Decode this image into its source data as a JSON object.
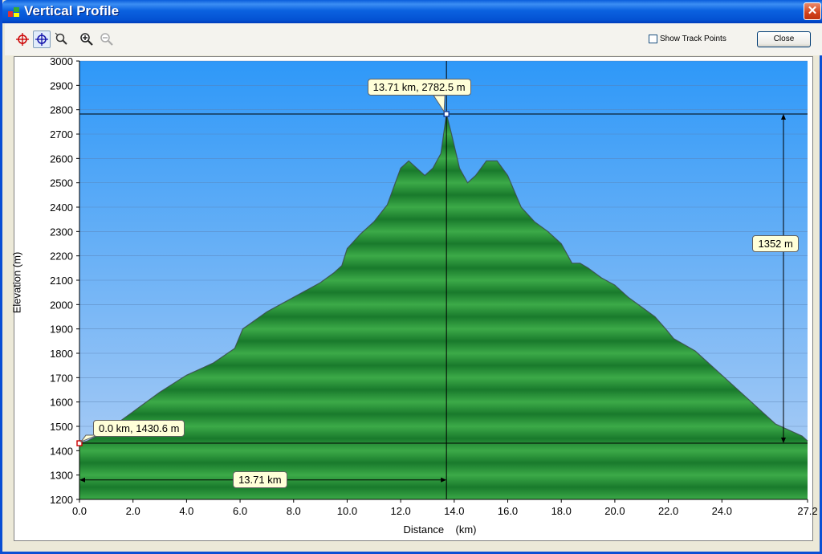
{
  "window": {
    "title": "Vertical Profile",
    "close_glyph": "✕"
  },
  "toolbar": {
    "tools": [
      {
        "icon": "crosshair-red-icon"
      },
      {
        "icon": "crosshair-blue-icon"
      },
      {
        "icon": "zoom-select-icon"
      },
      {
        "icon": "zoom-in-icon"
      },
      {
        "icon": "zoom-out-icon"
      }
    ],
    "show_track_points_label": "Show Track Points",
    "show_track_points_checked": false,
    "close_label": "Close"
  },
  "colors": {
    "sky_top": "#2e98f8",
    "sky_bottom": "#b4d0f4",
    "fill_light": "#3caa48",
    "fill_dark": "#197a2c"
  },
  "chart_data": {
    "type": "area",
    "title": "",
    "xlabel": "Distance    (km)",
    "ylabel": "Elevation (m)",
    "xlim": [
      0,
      27.2
    ],
    "ylim": [
      1200,
      3000
    ],
    "x_ticks": [
      "0.0",
      "2.0",
      "4.0",
      "6.0",
      "8.0",
      "10.0",
      "12.0",
      "14.0",
      "16.0",
      "18.0",
      "20.0",
      "22.0",
      "24.0",
      "27.2"
    ],
    "y_ticks": [
      1200,
      1300,
      1400,
      1500,
      1600,
      1700,
      1800,
      1900,
      2000,
      2100,
      2200,
      2300,
      2400,
      2500,
      2600,
      2700,
      2800,
      2900,
      3000
    ],
    "grid": true,
    "series": [
      {
        "x": [
          0,
          0.3,
          1,
          2,
          3,
          4,
          5,
          5.8,
          6.1,
          7,
          8,
          9,
          9.5,
          9.8,
          10,
          10.5,
          11,
          11.5,
          12,
          12.3,
          12.6,
          12.9,
          13.2,
          13.5,
          13.71,
          13.9,
          14.2,
          14.5,
          14.8,
          15.2,
          15.6,
          16,
          16.5,
          17,
          17.5,
          18,
          18.4,
          18.7,
          19,
          19.5,
          20,
          20.5,
          21,
          21.5,
          21.9,
          22.2,
          23,
          24,
          25,
          26,
          27,
          27.2
        ],
        "y": [
          1430.6,
          1440,
          1480,
          1560,
          1640,
          1710,
          1760,
          1820,
          1900,
          1970,
          2030,
          2090,
          2130,
          2160,
          2230,
          2290,
          2340,
          2410,
          2560,
          2590,
          2560,
          2530,
          2560,
          2620,
          2782.5,
          2700,
          2560,
          2500,
          2530,
          2590,
          2590,
          2530,
          2400,
          2340,
          2300,
          2250,
          2170,
          2170,
          2150,
          2110,
          2080,
          2030,
          1990,
          1950,
          1900,
          1860,
          1810,
          1710,
          1610,
          1510,
          1460,
          1440
        ]
      }
    ],
    "annotations": {
      "point_start": {
        "x": 0.0,
        "y": 1430.6,
        "label": "0.0 km, 1430.6 m"
      },
      "point_peak": {
        "x": 13.71,
        "y": 2782.5,
        "label": "13.71 km, 2782.5 m"
      },
      "distance_measure": {
        "label": "13.71 km",
        "y": 1280
      },
      "elevation_measure": {
        "label": "1352 m",
        "x": 26.3
      }
    }
  }
}
